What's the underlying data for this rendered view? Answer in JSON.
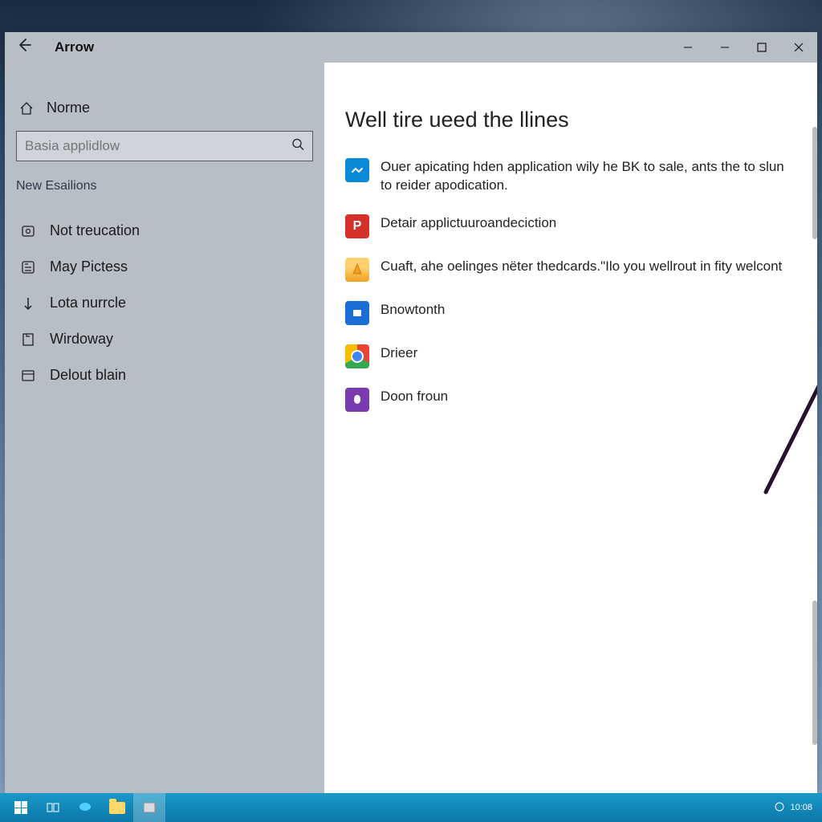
{
  "titlebar": {
    "title": "Arrow"
  },
  "sidebar": {
    "home_label": "Norme",
    "search_placeholder": "Basia applidlow",
    "section_label": "New Esailions",
    "items": [
      {
        "label": "Not treucation"
      },
      {
        "label": "May Pictess"
      },
      {
        "label": "Lota nurrcle"
      },
      {
        "label": "Wirdoway"
      },
      {
        "label": "Delout blain"
      }
    ]
  },
  "main": {
    "heading": "Well tire ueed the llines",
    "apps": [
      {
        "text": "Ouer apicating hden application wily he BK to sale, ants the to slun to reider apodication."
      },
      {
        "text": "Detair applictuuroandeciction"
      },
      {
        "text": "Cuaft, ahe oelinges nëter thedcards.\"Ilo you wellrout in fity welcont"
      },
      {
        "text": "Bnowtonth"
      },
      {
        "text": "Drieer"
      },
      {
        "text": "Doon froun"
      }
    ]
  },
  "taskbar": {
    "clock": "10:08"
  }
}
